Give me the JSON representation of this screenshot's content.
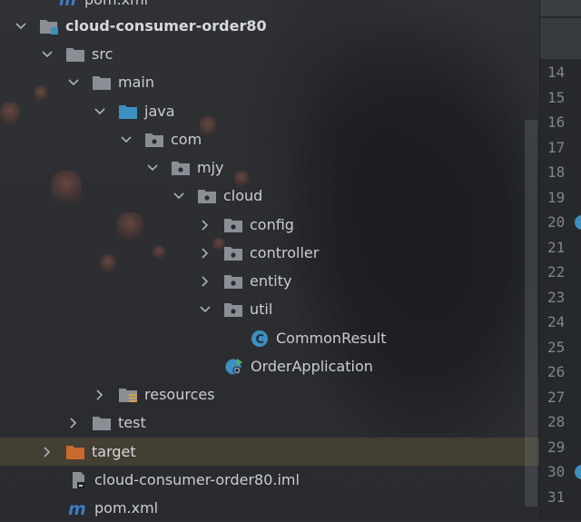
{
  "project_tree": {
    "partial_top": {
      "label": "pom.xml",
      "icon": "maven-icon"
    },
    "rows": [
      {
        "label": "cloud-consumer-order80",
        "icon": "module-folder-icon",
        "expanded": true,
        "bold": true
      },
      {
        "label": "src",
        "icon": "folder-icon",
        "expanded": true
      },
      {
        "label": "main",
        "icon": "folder-icon",
        "expanded": true
      },
      {
        "label": "java",
        "icon": "source-root-folder-icon",
        "expanded": true
      },
      {
        "label": "com",
        "icon": "package-icon",
        "expanded": true
      },
      {
        "label": "mjy",
        "icon": "package-icon",
        "expanded": true
      },
      {
        "label": "cloud",
        "icon": "package-icon",
        "expanded": true
      },
      {
        "label": "config",
        "icon": "package-icon",
        "expanded": false
      },
      {
        "label": "controller",
        "icon": "package-icon",
        "expanded": false
      },
      {
        "label": "entity",
        "icon": "package-icon",
        "expanded": false
      },
      {
        "label": "util",
        "icon": "package-icon",
        "expanded": true
      },
      {
        "label": "CommonResult",
        "icon": "java-class-icon"
      },
      {
        "label": "OrderApplication",
        "icon": "spring-boot-app-icon"
      },
      {
        "label": "resources",
        "icon": "resources-folder-icon",
        "expanded": false
      },
      {
        "label": "test",
        "icon": "folder-icon",
        "expanded": false
      },
      {
        "label": "target",
        "icon": "excluded-folder-icon",
        "expanded": false,
        "selected": true
      },
      {
        "label": "cloud-consumer-order80.iml",
        "icon": "iml-file-icon"
      },
      {
        "label": "pom.xml",
        "icon": "maven-icon"
      }
    ]
  },
  "editor_gutter": {
    "line_numbers": [
      "14",
      "15",
      "16",
      "17",
      "18",
      "19",
      "20",
      "21",
      "22",
      "23",
      "24",
      "25",
      "26",
      "27",
      "28",
      "29",
      "30",
      "31"
    ]
  },
  "colors": {
    "folder": "#8a8f96",
    "source_root": "#3d8fc0",
    "excluded_folder": "#c8692f",
    "java_class": "#3d8fc0",
    "maven": "#3d7bbf",
    "selection": "#4e4634"
  }
}
